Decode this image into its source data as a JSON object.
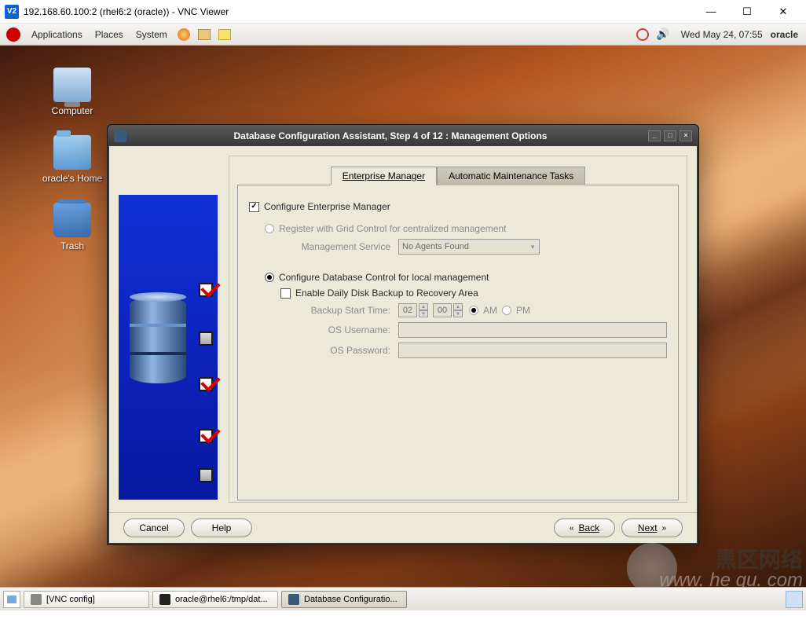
{
  "win": {
    "title": "192.168.60.100:2 (rhel6:2 (oracle)) - VNC Viewer",
    "logo_text": "V2"
  },
  "gnome": {
    "menus": [
      "Applications",
      "Places",
      "System"
    ],
    "clock": "Wed May 24, 07:55",
    "user": "oracle"
  },
  "desktop_icons": [
    {
      "label": "Computer",
      "glyph": "computer"
    },
    {
      "label": "oracle's Home",
      "glyph": "folder"
    },
    {
      "label": "Trash",
      "glyph": "trash"
    }
  ],
  "dbca": {
    "title": "Database Configuration Assistant, Step 4 of 12 : Management Options",
    "tabs": {
      "active": "Enterprise Manager",
      "inactive": "Automatic Maintenance Tasks"
    },
    "cfg_em_label": "Configure Enterprise Manager",
    "cfg_em_checked": true,
    "reg_grid_label": "Register with Grid Control for centralized management",
    "mgmt_svc_label": "Management Service",
    "mgmt_svc_value": "No Agents Found",
    "db_ctrl_label": "Configure Database Control for local management",
    "daily_backup_label": "Enable Daily Disk Backup to Recovery Area",
    "backup_time_label": "Backup Start Time:",
    "backup_hh": "02",
    "backup_mm": "00",
    "am_label": "AM",
    "pm_label": "PM",
    "os_user_label": "OS Username:",
    "os_pass_label": "OS Password:",
    "buttons": {
      "cancel": "Cancel",
      "help": "Help",
      "back": "Back",
      "next": "Next"
    }
  },
  "taskbar": {
    "items": [
      "[VNC config]",
      "oracle@rhel6:/tmp/dat...",
      "Database Configuratio..."
    ]
  },
  "watermark": {
    "ch": "黑区网络",
    "en": "www. he  qu. com"
  }
}
